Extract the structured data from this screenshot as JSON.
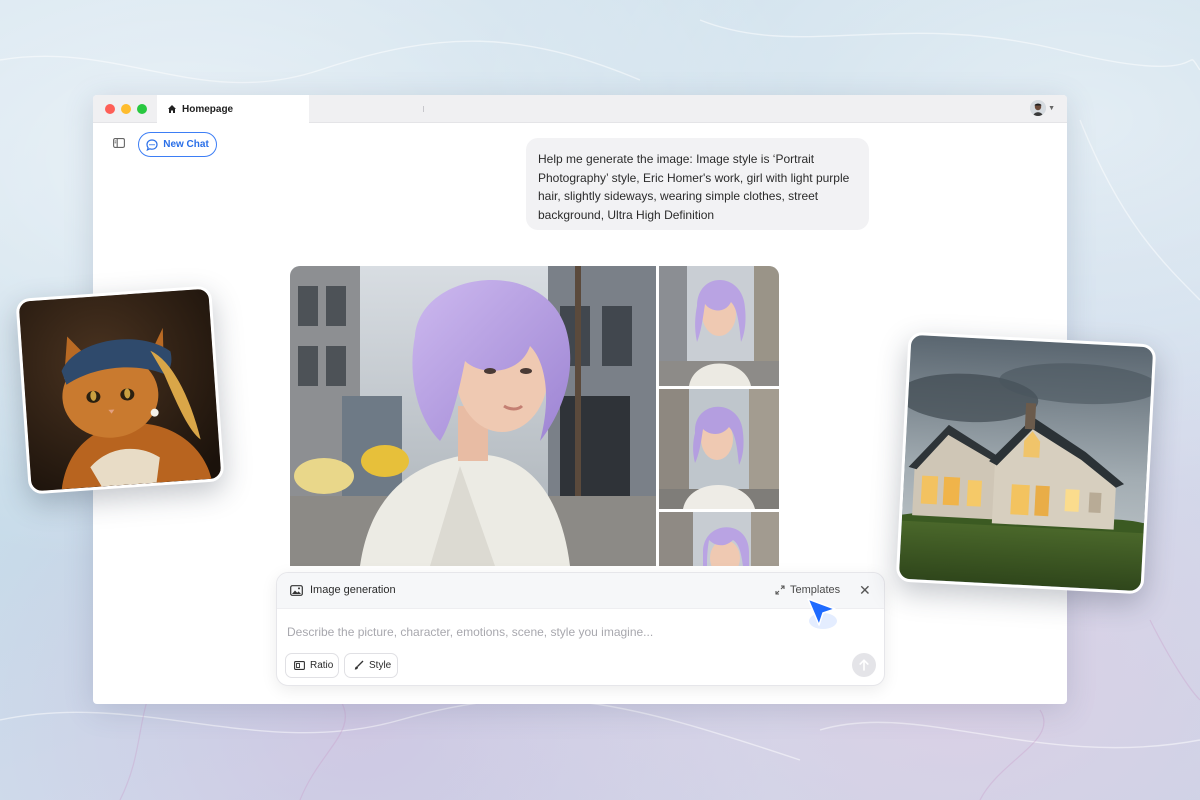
{
  "browser": {
    "tab_label": "Homepage"
  },
  "toolbar": {
    "new_chat_label": "New Chat"
  },
  "chat": {
    "user_message": "Help me generate the image: Image style is ‘Portrait Photography’ style, Eric Homer's work, girl with light purple hair, slightly sideways, wearing simple clothes, street background, Ultra High Definition"
  },
  "composer": {
    "mode_label": "Image generation",
    "templates_label": "Templates",
    "input_value": "",
    "input_placeholder": "Describe the picture, character, emotions, scene, style you imagine...",
    "ratio_label": "Ratio",
    "style_label": "Style"
  },
  "icons": {
    "tab": "home-icon",
    "sidebar": "sidebar-toggle-icon",
    "new_chat": "chat-bubble-icon",
    "mode": "image-icon",
    "templates": "expand-icon",
    "close": "close-icon",
    "ratio": "ratio-icon",
    "style": "brush-icon",
    "send": "arrow-up-icon",
    "cursor": "pointer-cursor-icon"
  },
  "colors": {
    "accent": "#2a6fe8",
    "cursor": "#1f6bff",
    "hair": "#b9a3e3",
    "window_bg": "#ffffff"
  }
}
